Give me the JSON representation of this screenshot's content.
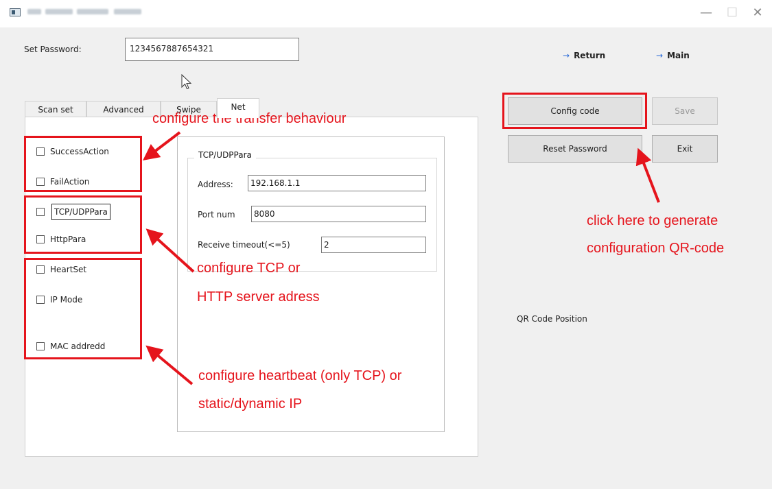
{
  "window": {
    "controls": {
      "minimize": "—",
      "maximize": "☐",
      "close": "✕"
    }
  },
  "password": {
    "label": "Set Password:",
    "value": "1234567887654321"
  },
  "nav": {
    "return_label": "Return",
    "main_label": "Main",
    "arrow": "→"
  },
  "tabs": [
    "Scan set",
    "Advanced",
    "Swipe",
    "Net"
  ],
  "checkboxes": {
    "success_action": "SuccessAction",
    "fail_action": "FailAction",
    "tcp_udp": "TCP/UDPPara",
    "http": "HttpPara",
    "heartset": "HeartSet",
    "ip_mode": "IP Mode",
    "mac": "MAC addredd"
  },
  "tcp_group": {
    "title": "TCP/UDPPara",
    "address_label": "Address:",
    "address_value": "192.168.1.1",
    "port_label": "Port num",
    "port_value": "8080",
    "timeout_label": "Receive timeout(<=5)",
    "timeout_value": "2"
  },
  "buttons": {
    "config_code": "Config code",
    "save": "Save",
    "reset_password": "Reset Password",
    "exit": "Exit"
  },
  "qr_position_label": "QR Code Position",
  "annotations": {
    "transfer": "configure the transfer behaviour",
    "tcp_line1": "configure TCP or",
    "tcp_line2": "HTTP server adress",
    "heartbeat_line1": "configure heartbeat (only TCP) or",
    "heartbeat_line2": "static/dynamic IP",
    "qr_line1": "click here to generate",
    "qr_line2": "configuration QR-code"
  },
  "colors": {
    "annotation_red": "#e5141c",
    "nav_arrow_blue": "#2a6ad8"
  }
}
